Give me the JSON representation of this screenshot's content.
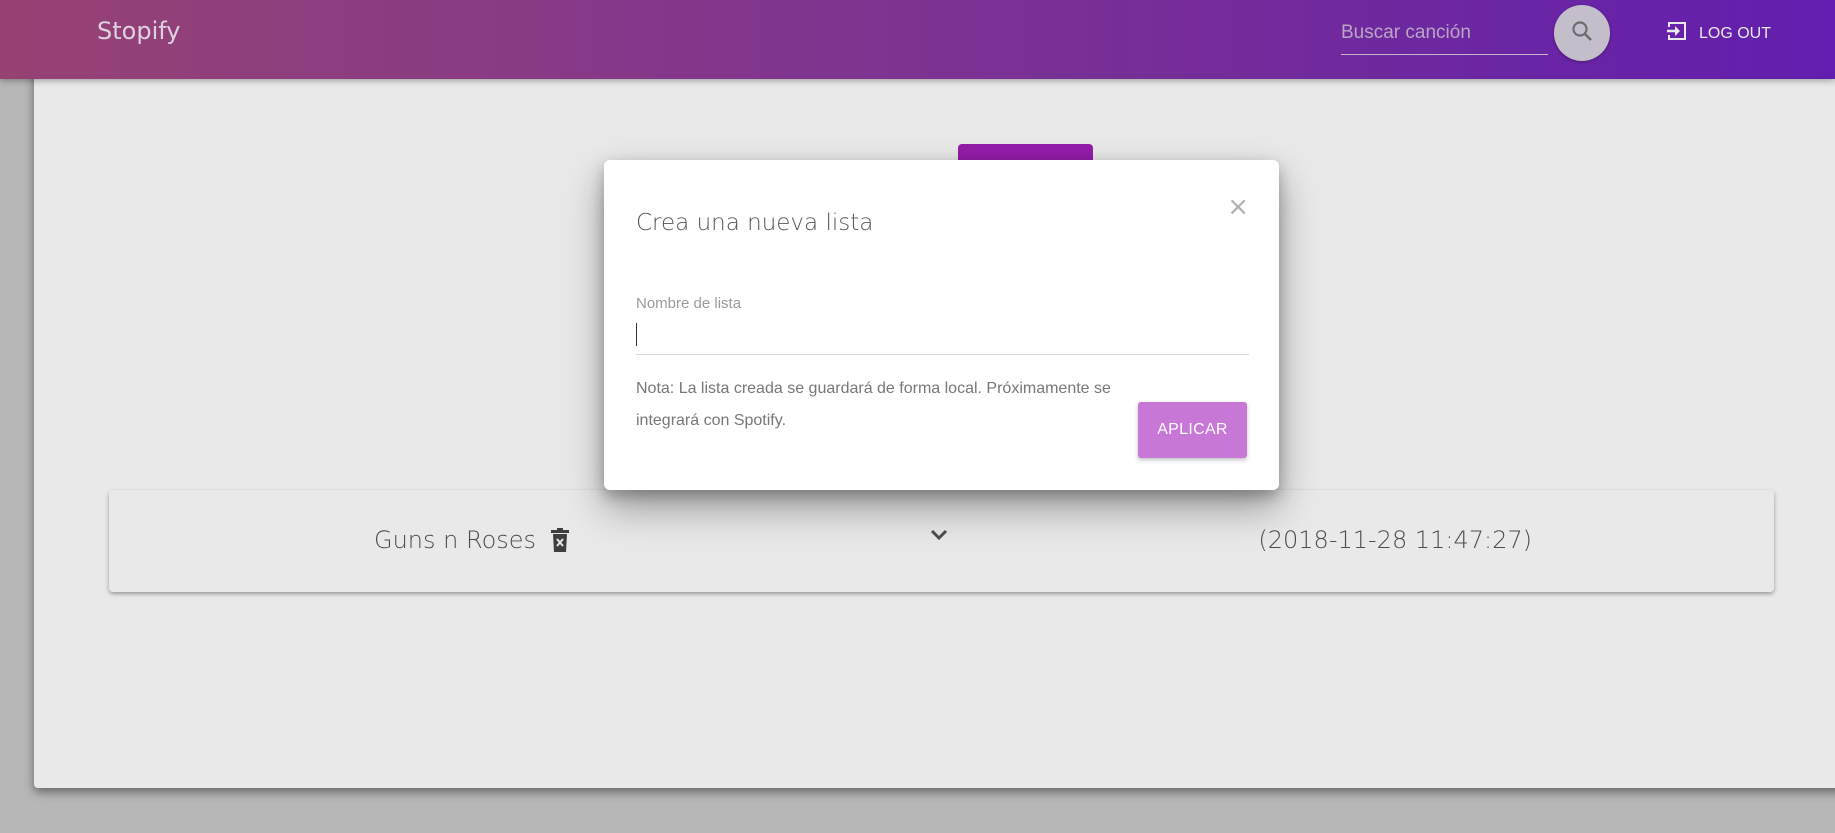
{
  "app": {
    "brand": "Stopify"
  },
  "header": {
    "search_placeholder": "Buscar canción",
    "search_value": "",
    "logout_label": "LOG OUT"
  },
  "playlists": [
    {
      "name": "Guns n Roses",
      "date": "(2018-11-28 11:47:27)"
    }
  ],
  "modal": {
    "title": "Crea una nueva lista",
    "close_symbol": "×",
    "field_label": "Nombre de lista",
    "field_value": "",
    "note": "Nota: La lista creada se guardará de forma local. Próximamente se integrará con Spotify.",
    "apply_label": "APLICAR"
  },
  "colors": {
    "navbar_start": "#a44a7e",
    "navbar_end": "#6c21c0",
    "apply_button": "#c777d6",
    "create_button": "#a020b8"
  },
  "icons": {
    "search": "search-icon",
    "logout": "logout-icon",
    "trash": "trash-icon",
    "chevron": "chevron-down-icon",
    "close": "close-icon"
  }
}
